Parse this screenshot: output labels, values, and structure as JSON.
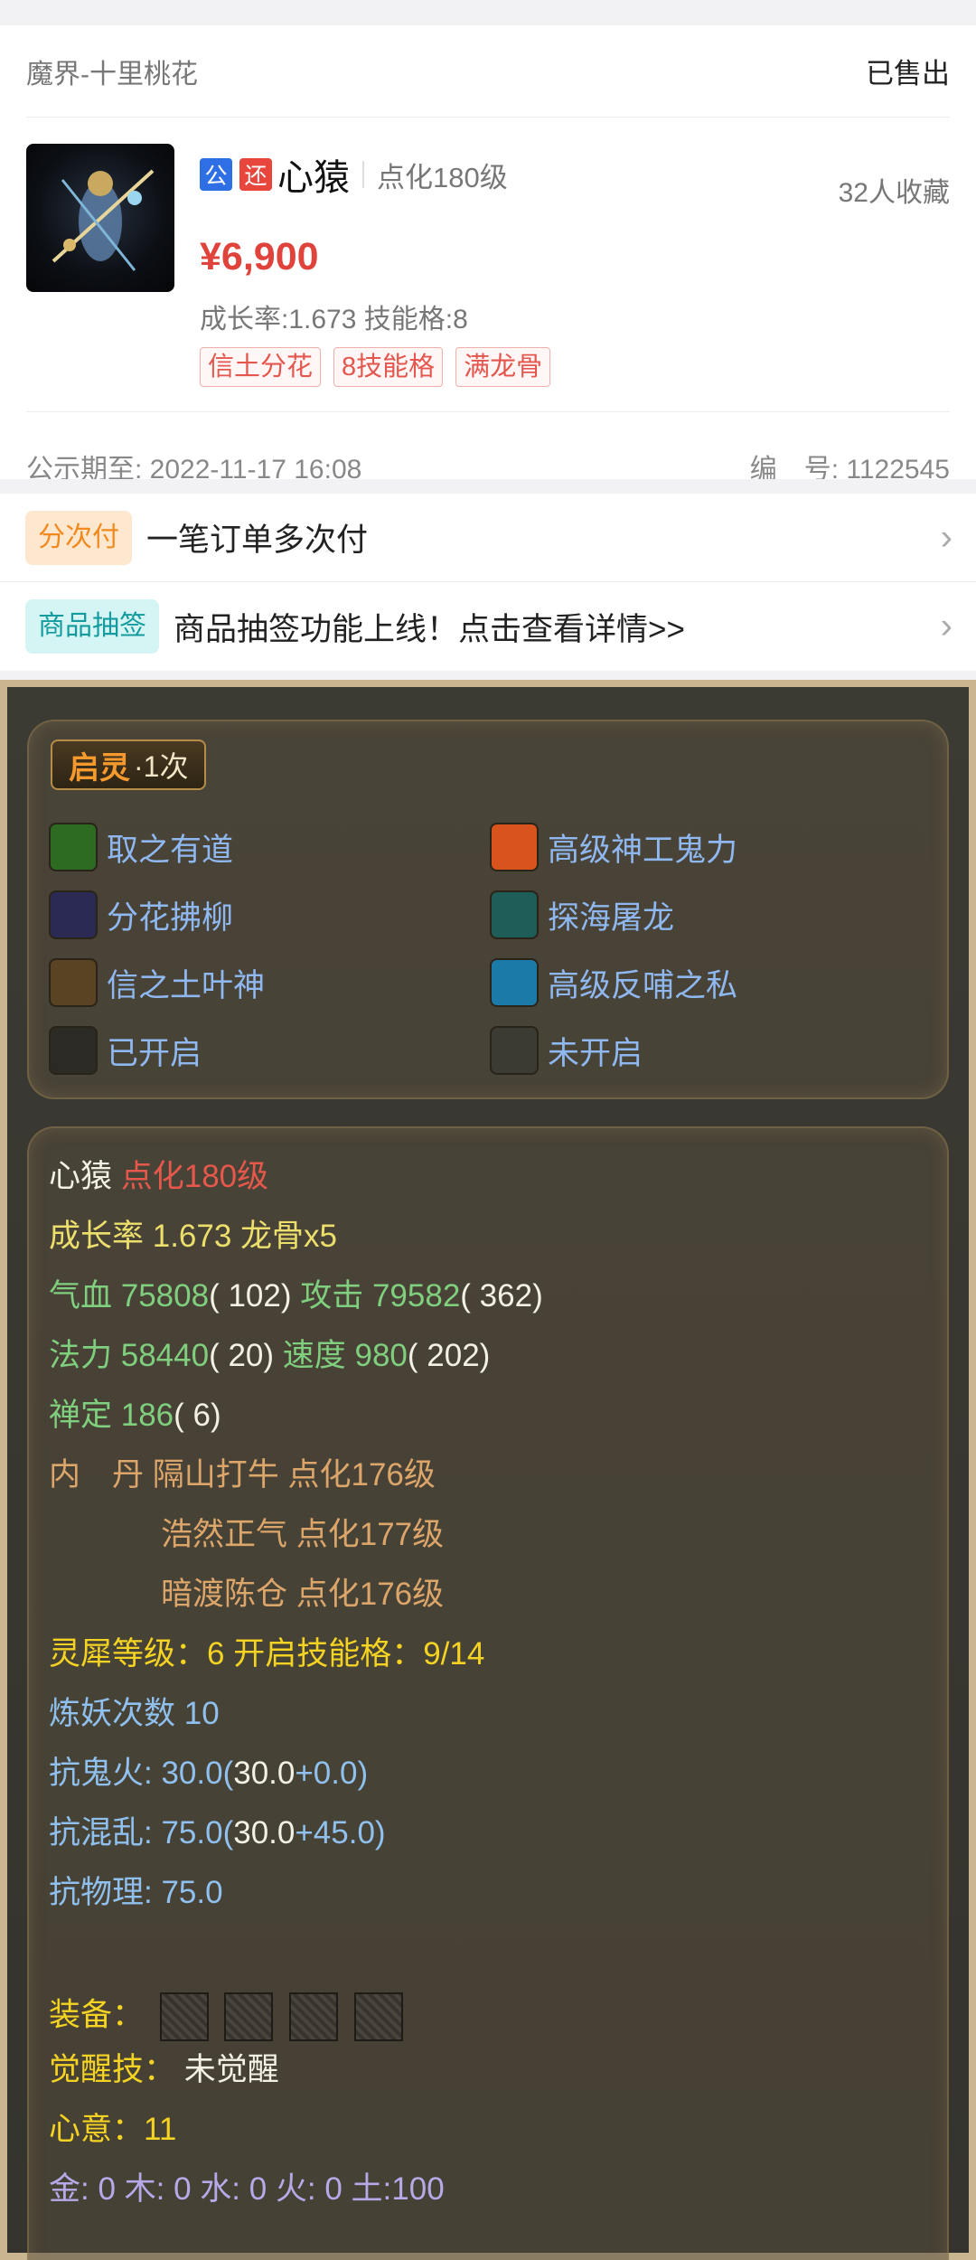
{
  "listing": {
    "server": "魔界-十里桃花",
    "status": "已售出",
    "tag_gong": "公",
    "tag_huan": "还",
    "pet_name": "心猿",
    "pet_level": "点化180级",
    "favorites": "32人收藏",
    "price": "¥6,900",
    "growth_skill": "成长率:1.673 技能格:8",
    "badges": [
      "信土分花",
      "8技能格",
      "满龙骨"
    ],
    "pub_date": "公示期至: 2022-11-17 16:08",
    "serial": "编　号: 1122545"
  },
  "promos": [
    {
      "tag": "分次付",
      "text": "一笔订单多次付"
    },
    {
      "tag": "商品抽签",
      "text": "商品抽签功能上线！点击查看详情>>"
    }
  ],
  "qiling": {
    "label": "启灵",
    "count": "·1次"
  },
  "skills": [
    {
      "name": "取之有道",
      "icon": "qu-zhi-you-dao-icon",
      "color": "#2e6b22"
    },
    {
      "name": "高级神工鬼力",
      "icon": "shen-gong-gui-li-icon",
      "color": "#d9541c"
    },
    {
      "name": "分花拂柳",
      "icon": "fen-hua-fu-liu-icon",
      "color": "#2a2a55"
    },
    {
      "name": "探海屠龙",
      "icon": "tan-hai-tu-long-icon",
      "color": "#1f5e58"
    },
    {
      "name": "信之土叶神",
      "icon": "xin-zhi-tu-ye-shen-icon",
      "color": "#5a4322"
    },
    {
      "name": "高级反哺之私",
      "icon": "fan-bu-zhi-si-icon",
      "color": "#1c7aa8"
    },
    {
      "name": "已开启",
      "icon": "opened-slot-icon",
      "color": "#2c2a25"
    },
    {
      "name": "未开启",
      "icon": "unopened-slot-icon",
      "color": "#3b3a33"
    }
  ],
  "stats": {
    "name": "心猿",
    "level": "点化180级",
    "growth_line": "成长率 1.673 龙骨x5",
    "hp_label": "气血 75808",
    "hp_extra": "( 102)",
    "atk_label": "攻击 79582",
    "atk_extra": "( 362)",
    "mp_label": "法力 58440",
    "mp_extra": "( 20)",
    "spd_label": "速度 980",
    "spd_extra": "( 202)",
    "zen_label": "禅定 186",
    "zen_extra": "( 6)",
    "neidan_title": "内　丹",
    "neidan_1": "隔山打牛 点化176级",
    "neidan_2": "浩然正气 点化177级",
    "neidan_3": "暗渡陈仓 点化176级",
    "lingxi": "灵犀等级：6 开启技能格：9/14",
    "lianyao": "炼妖次数 10",
    "kang_guihuo_a": "抗鬼火: 30.0(",
    "kang_guihuo_b": "30.0",
    "kang_guihuo_c": "+0.0)",
    "kang_hunluan_a": "抗混乱: 75.0(",
    "kang_hunluan_b": "30.0",
    "kang_hunluan_c": "+45.0)",
    "kang_wuli": "抗物理: 75.0",
    "equip_label": "装备：",
    "juexing_label": "觉醒技：",
    "juexing_value": "未觉醒",
    "xinyi": "心意：11",
    "elements": "金: 0 木: 0 水: 0 火: 0 土:100"
  }
}
